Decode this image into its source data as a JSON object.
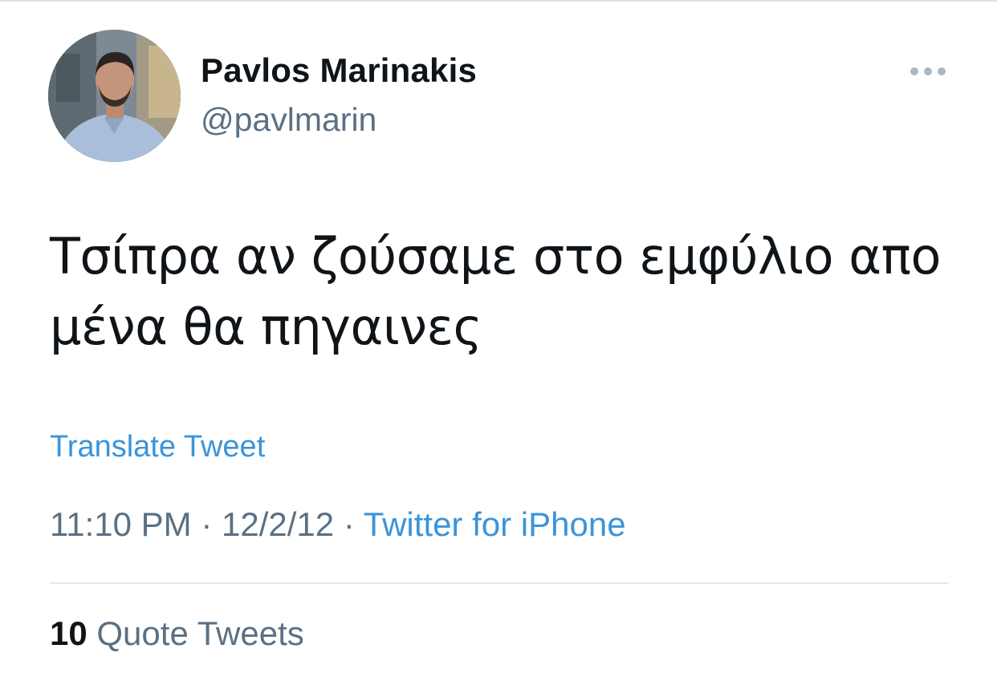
{
  "tweet": {
    "author": {
      "display_name": "Pavlos Marinakis",
      "handle": "@pavlmarin"
    },
    "text_line1": "Τσίπρα αν ζούσαμε στο εμφύλιο απο",
    "text_line2": "μένα θα πηγαινες",
    "translate_label": "Translate Tweet",
    "time": "11:10 PM",
    "separator": "·",
    "date": "12/2/12",
    "source": "Twitter for iPhone",
    "quote_count": "10",
    "quote_label": "Quote Tweets"
  },
  "icons": {
    "more": "more-horizontal-icon"
  },
  "colors": {
    "link": "#3b94d9",
    "secondary_text": "#5b7083",
    "primary_text": "#0f1419",
    "divider": "#e6e9ec"
  }
}
